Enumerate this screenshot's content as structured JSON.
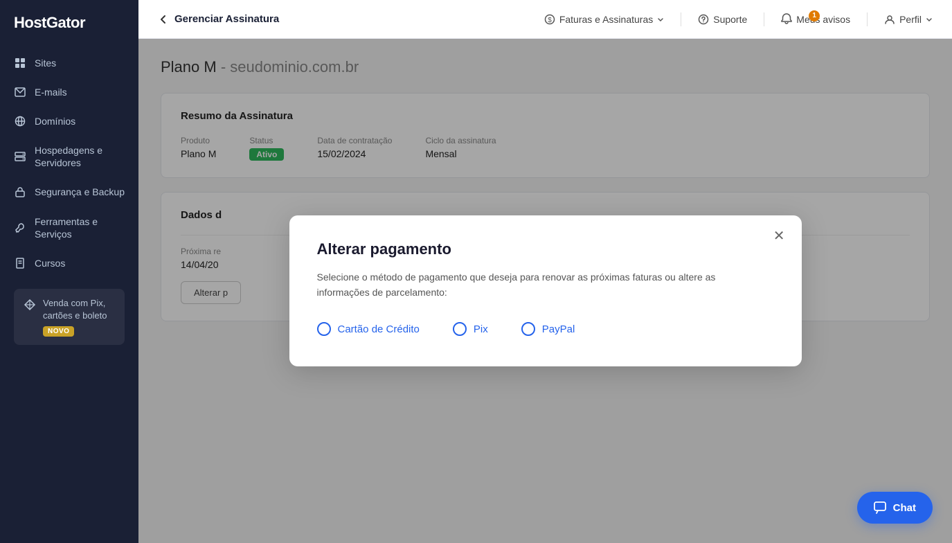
{
  "brand": "HostGator",
  "sidebar": {
    "items": [
      {
        "id": "sites",
        "label": "Sites",
        "icon": "grid"
      },
      {
        "id": "emails",
        "label": "E-mails",
        "icon": "mail"
      },
      {
        "id": "dominios",
        "label": "Domínios",
        "icon": "globe"
      },
      {
        "id": "hospedagens",
        "label": "Hospedagens e Servidores",
        "icon": "server"
      },
      {
        "id": "seguranca",
        "label": "Segurança e Backup",
        "icon": "lock"
      },
      {
        "id": "ferramentas",
        "label": "Ferramentas e Serviços",
        "icon": "wrench"
      },
      {
        "id": "cursos",
        "label": "Cursos",
        "icon": "book"
      }
    ],
    "promo": {
      "text": "Venda com Pix, cartões e boleto",
      "badge": "NOVO"
    }
  },
  "topbar": {
    "back_label": "Gerenciar Assinatura",
    "nav_items": [
      {
        "id": "faturas",
        "label": "Faturas e Assinaturas",
        "has_chevron": true
      },
      {
        "id": "suporte",
        "label": "Suporte"
      },
      {
        "id": "avisos",
        "label": "Meus avisos",
        "badge": "1"
      },
      {
        "id": "perfil",
        "label": "Perfil",
        "has_chevron": true
      }
    ]
  },
  "page": {
    "plan_name": "Plano M",
    "domain": "seudominio.com.br",
    "card_resumo": {
      "title": "Resumo da Assinatura",
      "fields": [
        {
          "label": "Produto",
          "value": "Plano M"
        },
        {
          "label": "Status",
          "value": "Ativo"
        },
        {
          "label": "Data de contratação",
          "value": "15/02/2024"
        },
        {
          "label": "Ciclo da assinatura",
          "value": "Mensal"
        }
      ]
    },
    "card_dados": {
      "title": "Dados d",
      "proxima_label": "Próxima re",
      "proxima_value": "14/04/20",
      "alterar_btn": "Alterar p"
    }
  },
  "modal": {
    "title": "Alterar pagamento",
    "description": "Selecione o método de pagamento que deseja para renovar as próximas faturas ou altere as informações de parcelamento:",
    "payment_options": [
      {
        "id": "cartao",
        "label": "Cartão de Crédito"
      },
      {
        "id": "pix",
        "label": "Pix"
      },
      {
        "id": "paypal",
        "label": "PayPal"
      }
    ]
  },
  "chat_btn": "Chat"
}
